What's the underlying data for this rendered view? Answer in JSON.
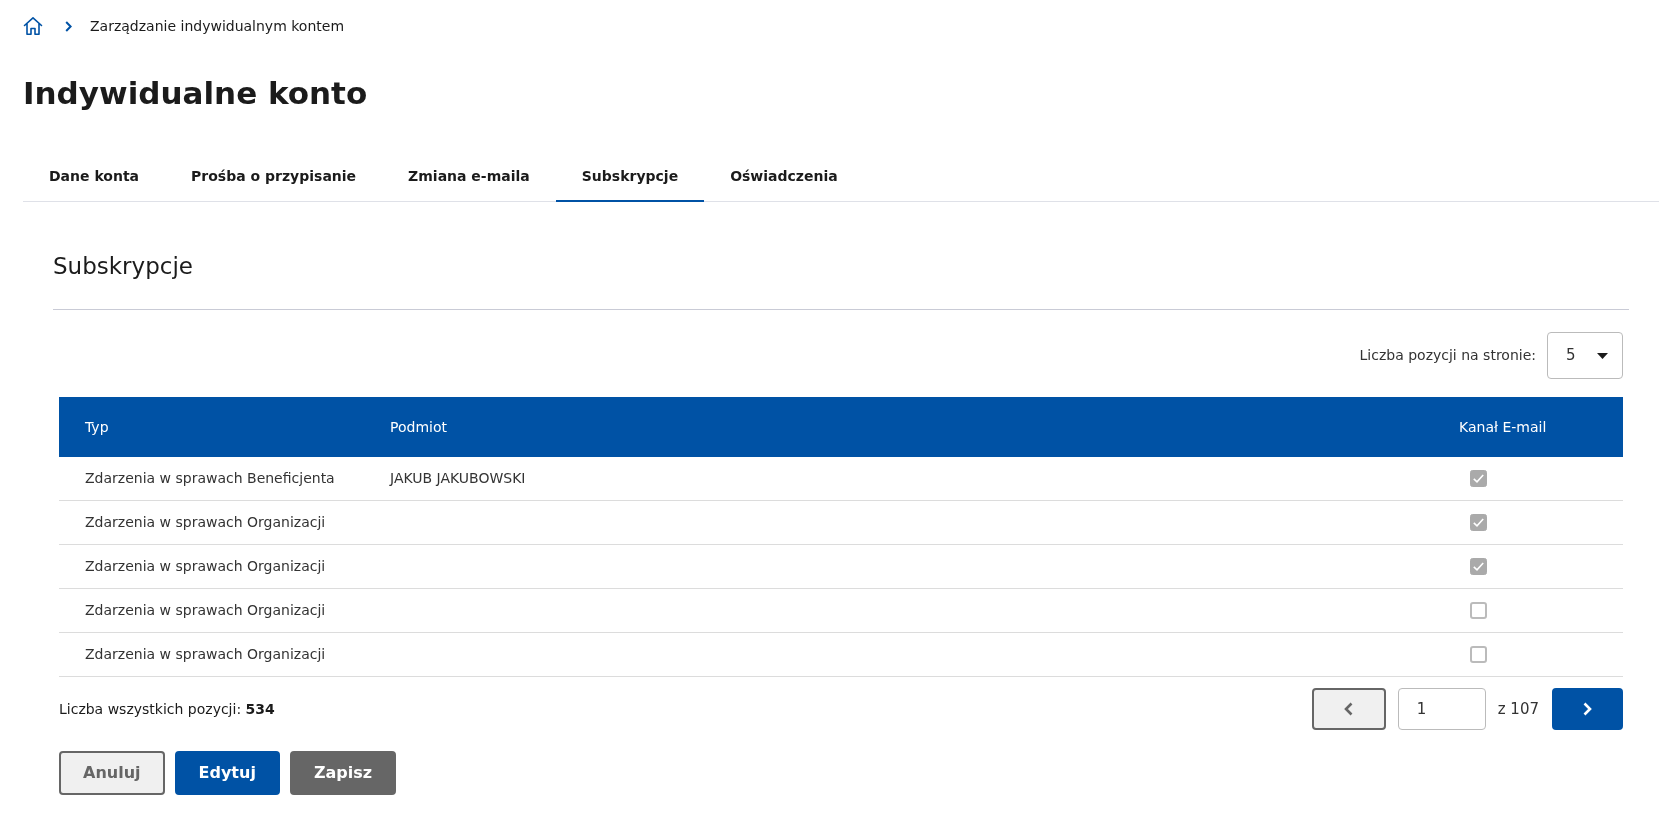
{
  "breadcrumb": [
    {
      "label": "Zarządzanie indywidualnym kontem"
    }
  ],
  "page_title": "Indywidualne konto",
  "tabs": [
    {
      "label": "Dane konta",
      "selected": false
    },
    {
      "label": "Prośba o przypisanie",
      "selected": false
    },
    {
      "label": "Zmiana e-maila",
      "selected": false
    },
    {
      "label": "Subskrypcje",
      "selected": true
    },
    {
      "label": "Oświadczenia",
      "selected": false
    }
  ],
  "section": {
    "title": "Subskrypcje",
    "page_size": {
      "label": "Liczba pozycji na stronie:",
      "value": "5"
    },
    "table": {
      "columns": [
        "Typ",
        "Podmiot",
        "Kanał E-mail"
      ],
      "rows": [
        {
          "type": "Zdarzenia w sprawach Beneficjenta",
          "subject": "JAKUB JAKUBOWSKI",
          "email_channel": true
        },
        {
          "type": "Zdarzenia w sprawach Organizacji",
          "email_channel": true
        },
        {
          "type": "Zdarzenia w sprawach Organizacji",
          "email_channel": true
        },
        {
          "type": "Zdarzenia w sprawach Organizacji",
          "email_channel": false
        },
        {
          "type": "Zdarzenia w sprawach Organizacji",
          "email_channel": false
        }
      ]
    },
    "total": "Liczba wszystkich pozycji: **534**",
    "pagination": {
      "prev": {
        "kind": "secondary"
      },
      "page": "1",
      "page_count": "z 107",
      "next": {
        "kind": "primary"
      }
    }
  },
  "buttons": [
    {
      "label": "Anuluj",
      "kind": "secondary",
      "disabled": false
    },
    {
      "label": "Edytuj",
      "kind": "primary",
      "disabled": false
    },
    {
      "label": "Zapisz",
      "kind": "primary",
      "disabled": true
    }
  ]
}
